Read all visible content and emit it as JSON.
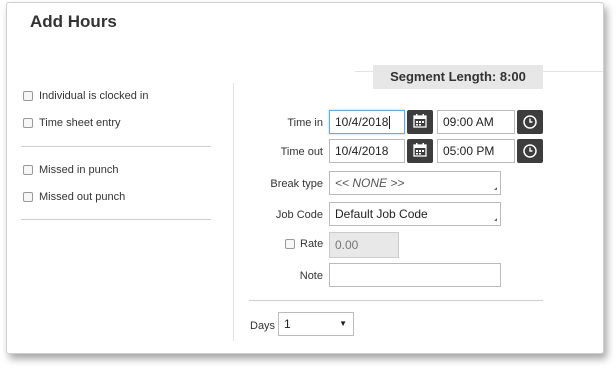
{
  "dialog": {
    "title": "Add Hours",
    "segment_length": "Segment Length: 8:00"
  },
  "left": {
    "checkboxes_group1": [
      {
        "label": "Individual is clocked in",
        "checked": false
      },
      {
        "label": "Time sheet entry",
        "checked": false
      }
    ],
    "checkboxes_group2": [
      {
        "label": "Missed in punch",
        "checked": false
      },
      {
        "label": "Missed out punch",
        "checked": false
      }
    ]
  },
  "form": {
    "time_in": {
      "label": "Time in",
      "date": "10/4/2018",
      "time": "09:00 AM"
    },
    "time_out": {
      "label": "Time out",
      "date": "10/4/2018",
      "time": "05:00 PM"
    },
    "break_type": {
      "label": "Break type",
      "value": "<< NONE >>"
    },
    "job_code": {
      "label": "Job Code",
      "value": "Default Job Code"
    },
    "rate": {
      "label": "Rate",
      "value": "0.00",
      "checked": false
    },
    "note": {
      "label": "Note",
      "value": ""
    },
    "days": {
      "label": "Days",
      "value": "1"
    }
  },
  "icons": [
    "calendar-icon",
    "clock-icon"
  ]
}
